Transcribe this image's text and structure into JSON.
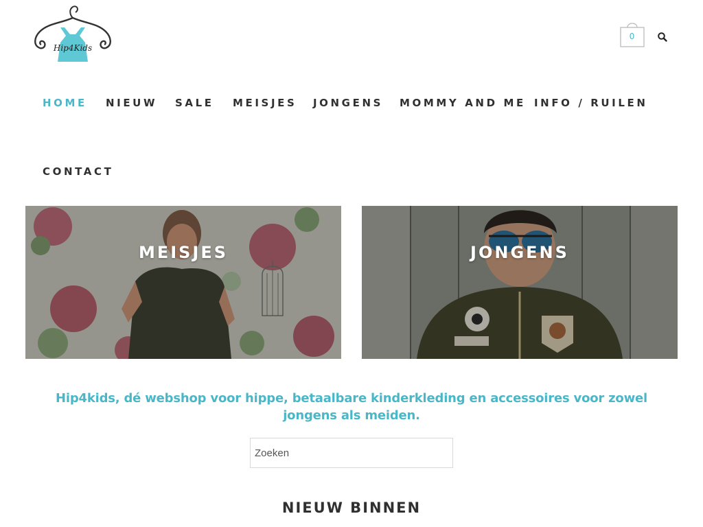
{
  "header": {
    "logo_text": "Hip4Kids",
    "cart_count": "0",
    "icons": {
      "cart": "shopping-bag-icon",
      "search": "search-icon"
    },
    "accent_color": "#4ab7c8"
  },
  "nav": {
    "items": [
      {
        "label": "HOME",
        "active": true
      },
      {
        "label": "NIEUW",
        "active": false
      },
      {
        "label": "SALE",
        "active": false
      },
      {
        "label": "MEISJES",
        "active": false
      },
      {
        "label": "JONGENS",
        "active": false
      },
      {
        "label": "MOMMY AND ME",
        "active": false
      },
      {
        "label": "INFO / RUILEN",
        "active": false
      },
      {
        "label": "CONTACT",
        "active": false
      }
    ]
  },
  "categories": [
    {
      "label": "MEISJES"
    },
    {
      "label": "JONGENS"
    }
  ],
  "tagline": "Hip4kids, dé webshop voor hippe, betaalbare kinderkleding en accessoires voor zowel jongens als meiden.",
  "search": {
    "placeholder": "Zoeken",
    "value": ""
  },
  "section": {
    "title": "NIEUW BINNEN"
  }
}
